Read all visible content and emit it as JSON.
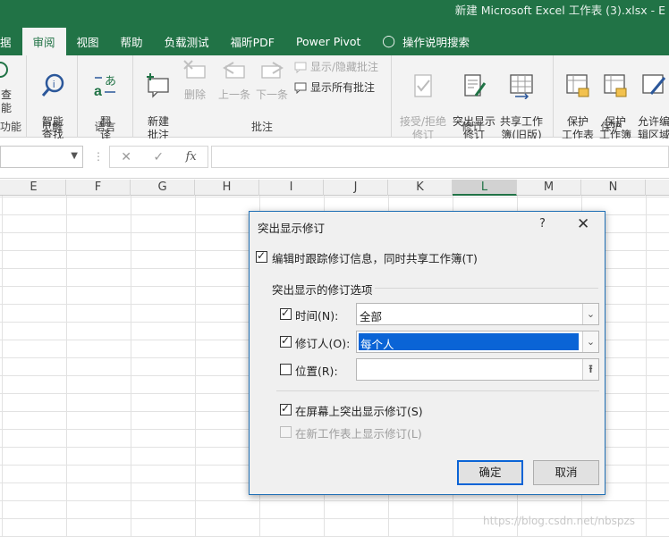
{
  "window": {
    "title": "新建 Microsoft Excel 工作表 (3).xlsx  -  E"
  },
  "ribbon_tabs": [
    {
      "label": "据"
    },
    {
      "label": "审阅"
    },
    {
      "label": "视图"
    },
    {
      "label": "帮助"
    },
    {
      "label": "负载测试"
    },
    {
      "label": "福昕PDF"
    },
    {
      "label": "Power Pivot"
    },
    {
      "label": "操作说明搜索"
    }
  ],
  "ribbon": {
    "groups": {
      "accessibility": {
        "label": "功能",
        "partial_line1": "查",
        "partial_line2": "能"
      },
      "insights": {
        "label": "见解",
        "button": "智能\n查找"
      },
      "language": {
        "label": "语言",
        "button": "翻\n译"
      },
      "comments": {
        "label": "批注",
        "new_comment": "新建\n批注",
        "delete": "删除",
        "previous": "上一条",
        "next": "下一条",
        "show_hide": "显示/隐藏批注",
        "show_all": "显示所有批注"
      },
      "changes": {
        "label": "修订",
        "accept_reject": "接受/拒绝\n修订",
        "highlight": "突出显示\n修订",
        "share_legacy": "共享工作\n簿(旧版)"
      },
      "protect": {
        "label": "保护",
        "protect_sheet": "保护\n工作表",
        "protect_workbook": "保护\n工作簿",
        "allow_edit": "允许编\n辑区域"
      }
    }
  },
  "formula_bar": {
    "cancel": "✕",
    "enter": "✓",
    "fx": "fx"
  },
  "columns": [
    "E",
    "F",
    "G",
    "H",
    "I",
    "J",
    "K",
    "L",
    "M",
    "N"
  ],
  "selected_column": "L",
  "dialog": {
    "title": "突出显示修订",
    "help": "?",
    "close": "✕",
    "track_changes": {
      "label": "编辑时跟踪修订信息，同时共享工作簿(T)",
      "checked": true
    },
    "section_title": "突出显示的修订选项",
    "when": {
      "label": "时间(N):",
      "checked": true,
      "value": "全部"
    },
    "who": {
      "label": "修订人(O):",
      "checked": true,
      "value": "每个人"
    },
    "where": {
      "label": "位置(R):",
      "checked": false,
      "value": ""
    },
    "highlight_on_screen": {
      "label": "在屏幕上突出显示修订(S)",
      "checked": true
    },
    "list_on_new_sheet": {
      "label": "在新工作表上显示修订(L)",
      "checked": false,
      "enabled": false
    },
    "ok": "确定",
    "cancel": "取消"
  },
  "watermark": "https://blog.csdn.net/nbspzs",
  "colors": {
    "excel_green": "#217346",
    "selection_blue": "#0a64d6"
  }
}
